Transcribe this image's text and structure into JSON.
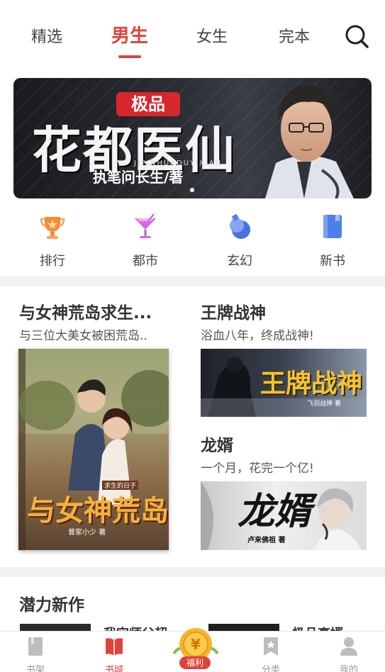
{
  "top_tabs": [
    {
      "label": "精选",
      "active": false
    },
    {
      "label": "男生",
      "active": true
    },
    {
      "label": "女生",
      "active": false
    },
    {
      "label": "完本",
      "active": false
    }
  ],
  "banner": {
    "badge": "极品",
    "title": "花都医仙",
    "pinyin": "JIPINHUADUYIXIAN",
    "author": "执笔问长生/著"
  },
  "categories": [
    {
      "label": "排行",
      "icon": "trophy-icon",
      "color": "#f58a3b"
    },
    {
      "label": "都市",
      "icon": "cocktail-icon",
      "color": "#d36be0"
    },
    {
      "label": "玄幻",
      "icon": "potion-icon",
      "color": "#5b7ff0"
    },
    {
      "label": "新书",
      "icon": "book-icon",
      "color": "#4f7fe8"
    }
  ],
  "featured": {
    "left": {
      "title": "与女神荒岛求生...",
      "desc": "与三位大美女被困荒岛..",
      "cover_text": "与女神荒岛",
      "cover_sub": "求生的日子",
      "cover_author": "曾家小少 著"
    },
    "right_top": {
      "title": "王牌战神",
      "desc": "浴血八年，终成战神!",
      "cover_text": "王牌战神",
      "cover_author": "飞羽战神 著"
    },
    "right_bottom": {
      "title": "龙婿",
      "desc": "一个月，花完一个亿!",
      "cover_text": "龙婿",
      "cover_author": "卢来佛祖 著"
    }
  },
  "potential": {
    "title": "潜力新作",
    "items": [
      "我宗师父超",
      "极品高婿"
    ]
  },
  "bottom_nav": [
    {
      "label": "书架",
      "icon": "bookshelf-icon",
      "active": false
    },
    {
      "label": "书城",
      "icon": "bookstore-icon",
      "active": true
    },
    {
      "label": "福利",
      "icon": "coin-icon",
      "active": false
    },
    {
      "label": "分类",
      "icon": "category-icon",
      "active": false
    },
    {
      "label": "我的",
      "icon": "profile-icon",
      "active": false
    }
  ],
  "colors": {
    "accent": "#e0433b",
    "divider": "#f2f2f2"
  }
}
